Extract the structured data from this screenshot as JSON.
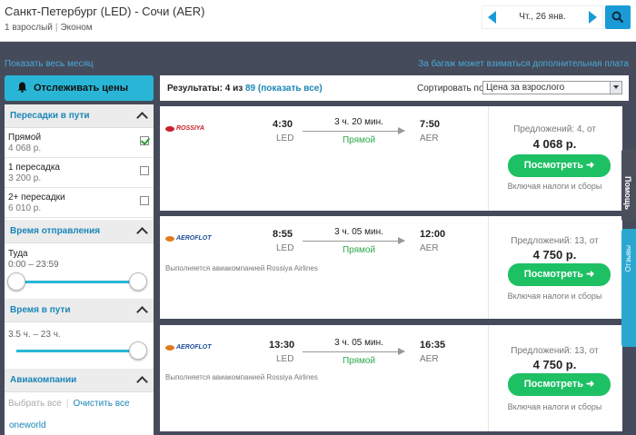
{
  "header": {
    "route": "Санкт-Петербург (LED) - Сочи (AER)",
    "passengers": "1 взрослый",
    "cabin": "Эконом",
    "date": "Чт., 26 янв."
  },
  "links": {
    "whole_month": "Показать весь месяц",
    "baggage_note": "За багаж может взиматься дополнительная плата"
  },
  "sidebar": {
    "track_prices": "Отслеживать цены",
    "stops_title": "Пересадки в пути",
    "stops": [
      {
        "label": "Прямой",
        "price": "4 068 р.",
        "checked": true
      },
      {
        "label": "1 пересадка",
        "price": "3 200 р.",
        "checked": false
      },
      {
        "label": "2+ пересадки",
        "price": "6 010 р.",
        "checked": false
      }
    ],
    "departure_title": "Время отправления",
    "departure_label": "Туда",
    "departure_range": "0:00 – 23:59",
    "duration_title": "Время в пути",
    "duration_range": "3.5 ч. – 23 ч.",
    "airlines_title": "Авиакомпании",
    "select_all": "Выбрать все",
    "clear_all": "Очистить все",
    "alliance": "oneworld"
  },
  "results": {
    "prefix": "Результаты: 4 из",
    "total": "89",
    "show_all": "(показать все)",
    "sort_label": "Сортировать по",
    "sort_value": "Цена за взрослого"
  },
  "flights": [
    {
      "airline_logo": "ROSSIYA",
      "operated_by": "",
      "dep_time": "4:30",
      "dep_code": "LED",
      "duration": "3 ч. 20 мин.",
      "stops": "Прямой",
      "arr_time": "7:50",
      "arr_code": "AER",
      "offers": "Предложений: 4, от",
      "price": "4 068 р.",
      "button": "Посмотреть ➜",
      "taxes": "Включая налоги и сборы"
    },
    {
      "airline_logo": "AEROFLOT",
      "operated_by": "Выполняется авиакомпанией Rossiya Airlines",
      "dep_time": "8:55",
      "dep_code": "LED",
      "duration": "3 ч. 05 мин.",
      "stops": "Прямой",
      "arr_time": "12:00",
      "arr_code": "AER",
      "offers": "Предложений: 13, от",
      "price": "4 750 р.",
      "button": "Посмотреть ➜",
      "taxes": "Включая налоги и сборы"
    },
    {
      "airline_logo": "AEROFLOT",
      "operated_by": "Выполняется авиакомпанией Rossiya Airlines",
      "dep_time": "13:30",
      "dep_code": "LED",
      "duration": "3 ч. 05 мин.",
      "stops": "Прямой",
      "arr_time": "16:35",
      "arr_code": "AER",
      "offers": "Предложений: 13, от",
      "price": "4 750 р.",
      "button": "Посмотреть ➜",
      "taxes": "Включая налоги и сборы"
    }
  ],
  "side_tabs": {
    "help": "Помощь",
    "feedback": "Отзывы"
  },
  "colors": {
    "accent": "#1a9bd7",
    "button_green": "#1ec064",
    "direct_green": "#2aa84a",
    "background": "#454b5a"
  }
}
